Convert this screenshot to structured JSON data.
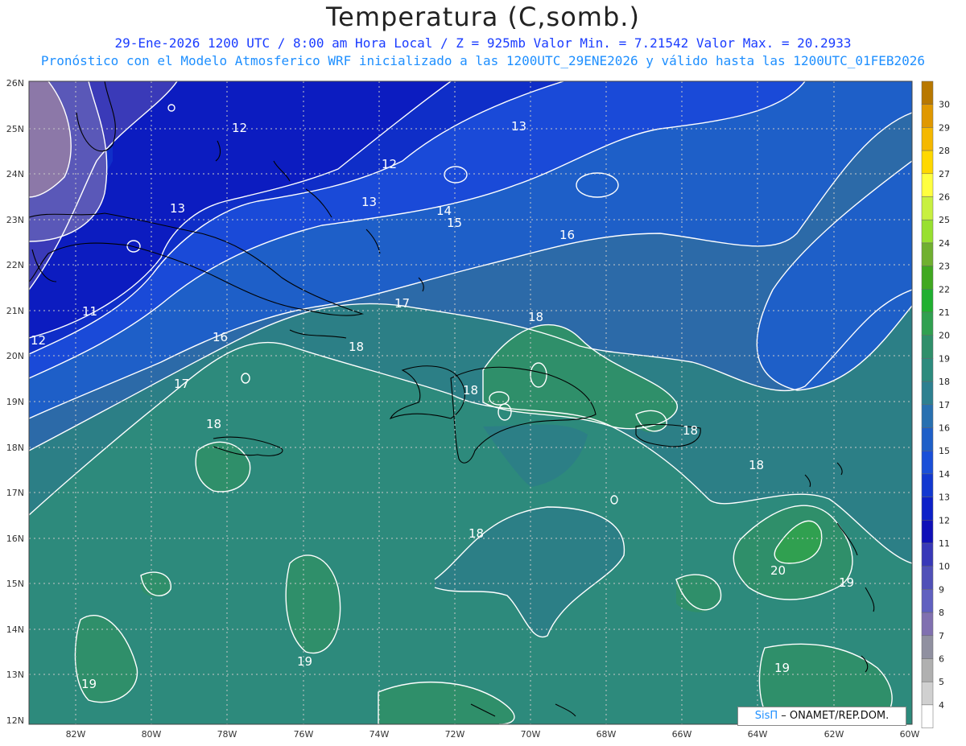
{
  "title": "Temperatura (C,somb.)",
  "subtitle1": "29-Ene-2026  1200 UTC / 8:00 am Hora Local / Z = 925mb    Valor Min. = 7.21542  Valor Max. = 20.2933",
  "subtitle2": "Pronóstico con el Modelo Atmosferico WRF inicializado a las 1200UTC_29ENE2026 y válido hasta las  1200UTC_01FEB2026",
  "footer": {
    "brand": "SisΠ",
    "text": "– ONAMET/REP.DOM."
  },
  "lat_labels": [
    "26N",
    "25N",
    "24N",
    "23N",
    "22N",
    "21N",
    "20N",
    "19N",
    "18N",
    "17N",
    "16N",
    "15N",
    "14N",
    "13N",
    "12N"
  ],
  "lon_labels": [
    "82W",
    "80W",
    "78W",
    "76W",
    "74W",
    "72W",
    "70W",
    "68W",
    "66W",
    "64W",
    "62W",
    "60W"
  ],
  "colorbar": {
    "labels": [
      "30",
      "29",
      "28",
      "27",
      "26",
      "25",
      "24",
      "23",
      "22",
      "21",
      "20",
      "19",
      "18",
      "17",
      "16",
      "15",
      "14",
      "13",
      "12",
      "11",
      "10",
      "9",
      "8",
      "7",
      "6",
      "5",
      "4"
    ],
    "colors": [
      "#b87800",
      "#e09800",
      "#f5b800",
      "#ffd800",
      "#ffff40",
      "#c8f040",
      "#98e030",
      "#70b030",
      "#40a820",
      "#20b030",
      "#30a050",
      "#2f8f6a",
      "#2c8b7e",
      "#2d8090",
      "#2870b0",
      "#1e5fc8",
      "#1a4fd8",
      "#1238d0",
      "#0c20c8",
      "#1010b8",
      "#3838b8",
      "#5050b8",
      "#6060c0",
      "#8070b0",
      "#9090a0",
      "#b0b0b0",
      "#d0d0d0",
      "#ffffff"
    ]
  },
  "contour_labels": [
    "12",
    "13",
    "12",
    "13",
    "14",
    "15",
    "16",
    "13",
    "11",
    "12",
    "16",
    "17",
    "17",
    "18",
    "18",
    "18",
    "18",
    "18",
    "18",
    "18",
    "19",
    "19",
    "19",
    "19",
    "20"
  ]
}
